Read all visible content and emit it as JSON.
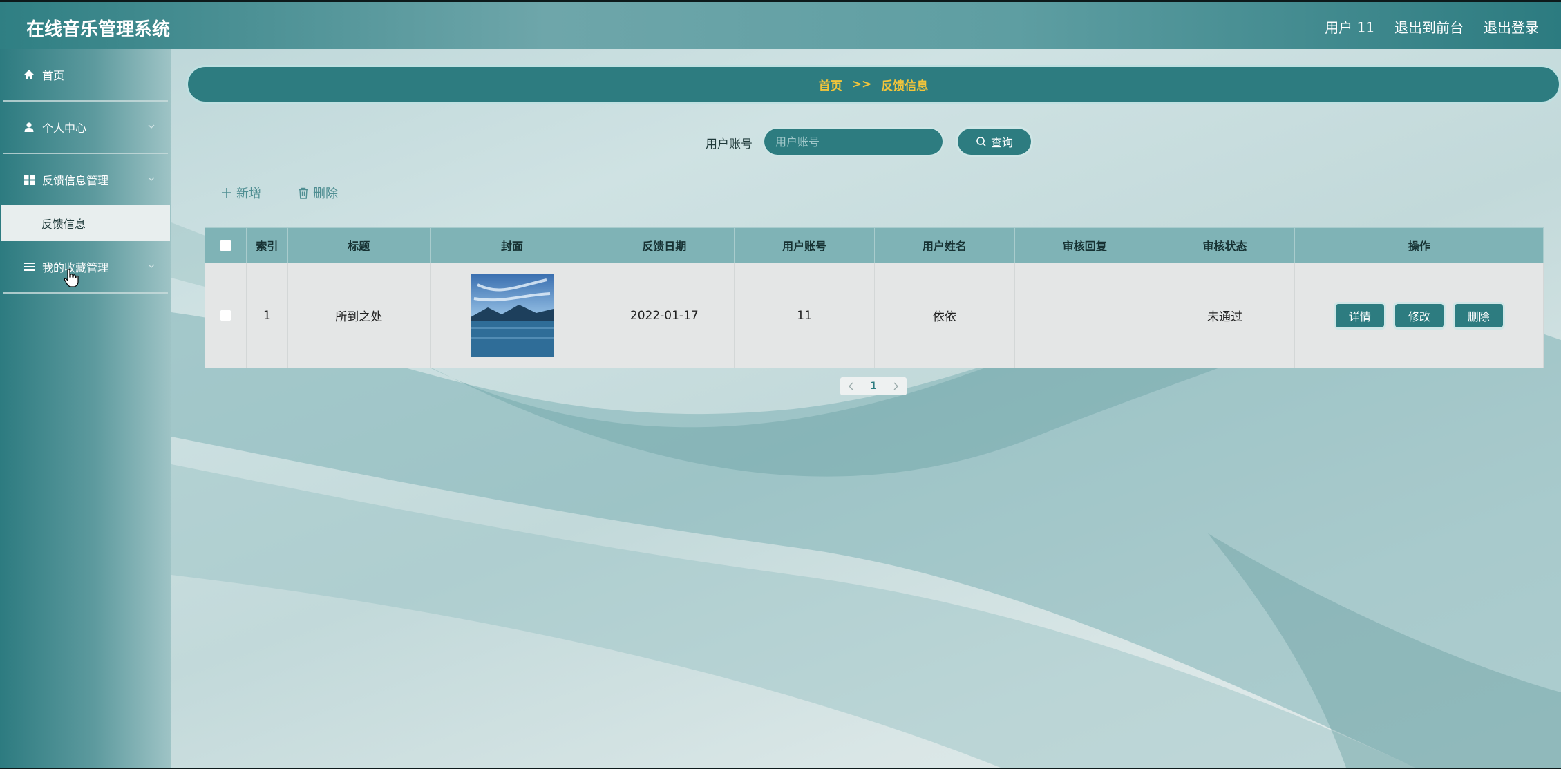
{
  "app": {
    "title": "在线音乐管理系统"
  },
  "header": {
    "user": "用户 11",
    "to_front": "退出到前台",
    "logout": "退出登录"
  },
  "sidebar": {
    "items": [
      {
        "label": "首页",
        "icon": "home-icon"
      },
      {
        "label": "个人中心",
        "icon": "user-icon"
      },
      {
        "label": "反馈信息管理",
        "icon": "grid-icon"
      },
      {
        "label": "我的收藏管理",
        "icon": "list-icon"
      }
    ],
    "sub_item": "反馈信息"
  },
  "breadcrumb": {
    "home": "首页",
    "sep": ">>",
    "current": "反馈信息"
  },
  "search": {
    "label": "用户账号",
    "placeholder": "用户账号",
    "button": "查询"
  },
  "toolbar": {
    "add": "新增",
    "delete": "删除"
  },
  "table": {
    "headers": [
      "索引",
      "标题",
      "封面",
      "反馈日期",
      "用户账号",
      "用户姓名",
      "审核回复",
      "审核状态",
      "操作"
    ],
    "rows": [
      {
        "index": "1",
        "title": "所到之处",
        "date": "2022-01-17",
        "account": "11",
        "name": "依依",
        "reply": "",
        "status": "未通过"
      }
    ],
    "actions": {
      "detail": "详情",
      "edit": "修改",
      "delete": "删除"
    }
  },
  "pagination": {
    "current": "1"
  },
  "colors": {
    "primary": "#2d7c80",
    "accent": "#f3c53a",
    "header_bg": "#7fb3b6"
  }
}
